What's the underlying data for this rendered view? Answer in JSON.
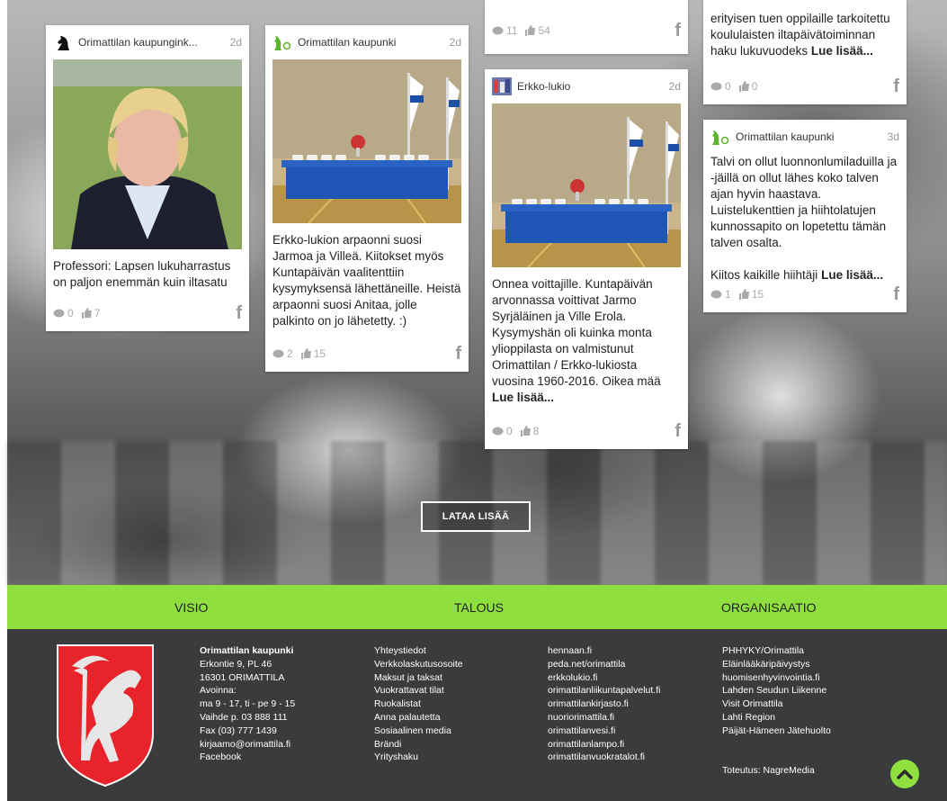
{
  "cards": {
    "c1": {
      "source": "Orimattilan kaupungink...",
      "age": "2d",
      "text": "Professori: Lapsen lukuharrastus on paljon enemmän kuin iltasatu",
      "comments": "0",
      "likes": "7"
    },
    "c2": {
      "source": "Orimattilan kaupunki",
      "age": "2d",
      "text": "Erkko-lukion arpaonni suosi Jarmoa ja Villeä. Kiitokset myös Kuntapäivän vaalitenttiin kysymyksensä lähettäneille. Heistä arpaonni suosi Anitaa, jolle palkinto on jo lähetetty. :)",
      "comments": "2",
      "likes": "15"
    },
    "c3": {
      "comments": "11",
      "likes": "54"
    },
    "c4": {
      "source": "Erkko-lukio",
      "age": "2d",
      "text_main": "Onnea voittajille. Kuntapäivän arvonnassa voittivat Jarmo Syrjäläinen ja Ville Erola. Kysymyshän oli kuinka monta ylioppilasta on valmistunut Orimattilan / Erkko-lukiosta vuosina 1960-2016. Oikea mää",
      "more": "Lue lisää...",
      "comments": "0",
      "likes": "8"
    },
    "c5": {
      "text_main": "erityisen tuen oppilaille tarkoitettu koululaisten iltapäivätoiminnan haku lukuvuodeks",
      "more": "Lue lisää...",
      "comments": "0",
      "likes": "0"
    },
    "c6": {
      "source": "Orimattilan kaupunki",
      "age": "3d",
      "text_main": "Talvi on ollut luonnonlumiladuilla ja -jäillä on ollut lähes koko talven ajan hyvin haastava. Luistelukenttien ja hiihtolatujen kunnossapito on lopetettu tämän talven osalta.",
      "text_thanks": "Kiitos kaikille hiihtäji",
      "more": "Lue lisää...",
      "comments": "1",
      "likes": "15"
    }
  },
  "load_more": "LATAA LISÄÄ",
  "nav": {
    "visio": "VISIO",
    "talous": "TALOUS",
    "organisaatio": "ORGANISAATIO"
  },
  "footer": {
    "contact": {
      "name": "Orimattilan kaupunki",
      "street": "Erkontie 9, PL 46",
      "postal": "16301 ORIMATTILA",
      "open_label": "Avoinna:",
      "open_hours": "ma 9 - 17, ti - pe 9 - 15",
      "phone": "Vaihde p. 03 888 111",
      "fax": "Fax (03) 777 1439",
      "email": "kirjaamo@orimattila.fi",
      "facebook": "Facebook"
    },
    "links1": [
      "Yhteystiedot",
      "Verkkolaskutusosoite",
      "Maksut ja taksat",
      "Vuokrattavat tilat",
      "Ruokalistat",
      "Anna palautetta",
      "Sosiaalinen media",
      "Brändi",
      "Yrityshaku"
    ],
    "links2": [
      "hennaan.fi",
      "peda.net/orimattila",
      "erkkolukio.fi",
      "orimattilanliikuntapalvelut.fi",
      "orimattilankirjasto.fi",
      "nuoriorimattila.fi",
      "orimattilanvesi.fi",
      "orimattilanlampo.fi",
      "orimattilanvuokratalot.fi"
    ],
    "links3": [
      "PHHYKY/Orimattila",
      "Eläinlääkäripäivystys",
      "huomisenhyvinvointia.fi",
      "Lahden Seudun Liikenne",
      "Visit Orimattila",
      "Lahti Region",
      "Päijät-Hämeen Jätehuolto"
    ],
    "credit": "Toteutus: NagreMedia"
  },
  "colors": {
    "accent_green": "#8fdf3e",
    "footer_bg": "#3a3b3c"
  }
}
